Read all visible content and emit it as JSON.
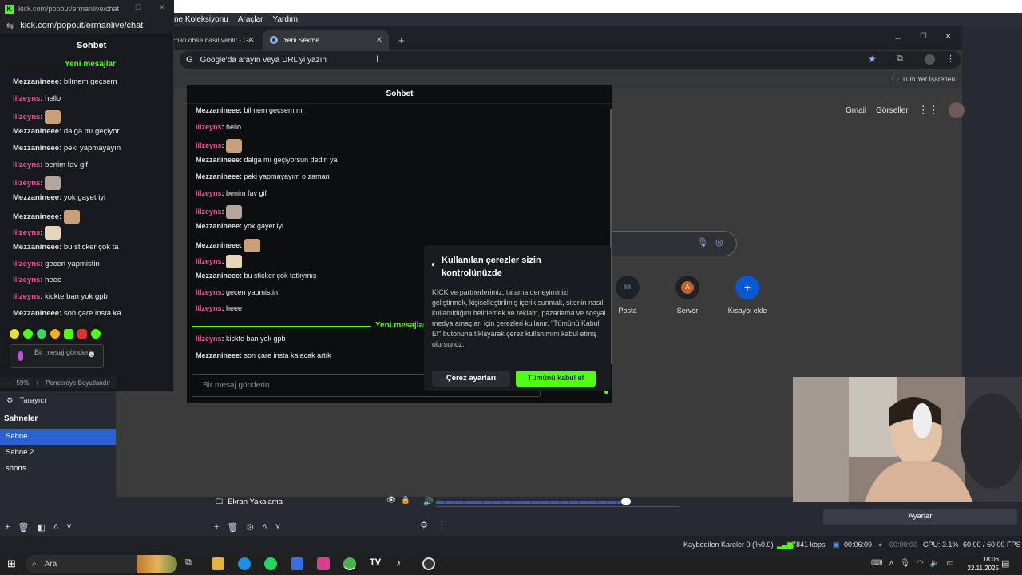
{
  "obs": {
    "menu": [
      "ne Koleksiyonu",
      "Araçlar",
      "Yardım"
    ],
    "zoom": "59%",
    "zoom_label": "Pencereye Boyutlandır",
    "browser_source": "Tarayıcı",
    "scenes_title": "Sahneler",
    "scenes": [
      "Sahne",
      "Sahne 2",
      "shorts"
    ],
    "source_name": "Ekran Yakalama",
    "settings_button": "Ayarlar",
    "status": {
      "dropped": "Kaybedilen Kareler 0 (%0.0)",
      "bitrate": "7841 kbps",
      "stream_time": "00:06:09",
      "rec_time": "00:00:00",
      "cpu": "CPU: 3.1%",
      "fps": "60.00 / 60.00 FPS"
    }
  },
  "popout": {
    "url_tab": "kick.com/popout/ermanlive/chat",
    "url": "kick.com/popout/ermanlive/chat",
    "title": "Sohbet",
    "new_messages": "Yeni mesajlar",
    "input_placeholder": "Bir mesaj gönderin",
    "messages": [
      {
        "user": "Mezzanineee",
        "type": "m",
        "text": "bilmem geçsem"
      },
      {
        "user": "lilzeyns",
        "type": "l",
        "text": "hello"
      },
      {
        "user": "lilzeyns",
        "type": "l",
        "text": ""
      },
      {
        "user": "Mezzanineee",
        "type": "m",
        "text": "dalga mı geçiyor"
      },
      {
        "user": "Mezzanineee",
        "type": "m",
        "text": "peki yapmayayın"
      },
      {
        "user": "lilzeyns",
        "type": "l",
        "text": "benim fav gif"
      },
      {
        "user": "lilzeyns",
        "type": "l",
        "text": ""
      },
      {
        "user": "Mezzanineee",
        "type": "m",
        "text": "yok gayet iyi"
      },
      {
        "user": "Mezzanineee",
        "type": "m",
        "text": ""
      },
      {
        "user": "lilzeyns",
        "type": "l",
        "text": ""
      },
      {
        "user": "Mezzanineee",
        "type": "m",
        "text": "bu sticker çok ta"
      },
      {
        "user": "lilzeyns",
        "type": "l",
        "text": "gecen yapmistin"
      },
      {
        "user": "lilzeyns",
        "type": "l",
        "text": "heee"
      },
      {
        "user": "lilzeyns",
        "type": "l",
        "text": "kickte ban yok gpb"
      },
      {
        "user": "Mezzanineee",
        "type": "m",
        "text": "son çare insta ka"
      }
    ]
  },
  "chrome": {
    "tabs": [
      "Kick chati obse nasıl verilir - Go",
      "Yeni Sekme"
    ],
    "omnibox_placeholder": "Google'da arayın veya URL'yi yazın",
    "bookmarks_all": "Tüm Yer İşaretleri",
    "google_links": [
      "Gmail",
      "Görseller"
    ],
    "shortcuts": [
      {
        "label": "Posta",
        "glyph": "✉"
      },
      {
        "label": "Server",
        "glyph": "A"
      },
      {
        "label": "Kısayol ekle",
        "glyph": "+"
      }
    ]
  },
  "kickchat": {
    "title": "Sohbet",
    "new_messages": "Yeni mesajlar",
    "input_placeholder": "Bir mesaj gönderin",
    "messages": [
      {
        "user": "Mezzanineee",
        "type": "m",
        "text": "bilmem geçsem mi"
      },
      {
        "user": "lilzeyns",
        "type": "l",
        "text": "hello"
      },
      {
        "user": "lilzeyns",
        "type": "l",
        "text": ""
      },
      {
        "user": "Mezzanineee",
        "type": "m",
        "text": "dalga mı geçiyorsun dedin ya"
      },
      {
        "user": "Mezzanineee",
        "type": "m",
        "text": "peki yapmayayım o zaman"
      },
      {
        "user": "lilzeyns",
        "type": "l",
        "text": "benim fav gif"
      },
      {
        "user": "lilzeyns",
        "type": "l",
        "text": ""
      },
      {
        "user": "Mezzanineee",
        "type": "m",
        "text": "yok gayet iyi"
      },
      {
        "user": "Mezzanineee",
        "type": "m",
        "text": ""
      },
      {
        "user": "lilzeyns",
        "type": "l",
        "text": ""
      },
      {
        "user": "Mezzanineee",
        "type": "m",
        "text": "bu sticker çok tatlıymış"
      },
      {
        "user": "lilzeyns",
        "type": "l",
        "text": "gecen yapmistin"
      },
      {
        "user": "lilzeyns",
        "type": "l",
        "text": "heee"
      },
      {
        "user": "lilzeyns",
        "type": "l",
        "text": "kickte ban yok gpb"
      },
      {
        "user": "Mezzanineee",
        "type": "m",
        "text": "son çare insta kalacak artık"
      }
    ]
  },
  "cookie": {
    "title": "Kullanılan çerezler sizin kontrolünüzde",
    "body": "KICK ve partnerlerimiz, tarama deneyiminizi geliştirmek, kişiselleştirilmiş içerik sunmak, sitenin nasıl kullanıldığını belirlemek ve reklam, pazarlama ve sosyal medya amaçları için çerezleri kullanır. \"Tümünü Kabul Et\" butonuna tıklayarak çerez kullanımını kabul etmiş olursunuz.",
    "settings_button": "Çerez ayarları",
    "accept_button": "Tümünü kabul et"
  },
  "taskbar": {
    "search": "Ara",
    "time": "18:06",
    "date": "22.11.2025"
  },
  "colors": {
    "kick_green": "#53fc18",
    "user_pink": "#e55a99",
    "obs_blue": "#2c61d4"
  }
}
